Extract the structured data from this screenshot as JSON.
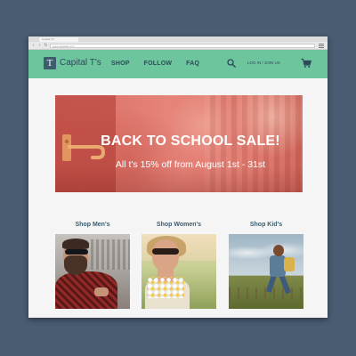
{
  "browser": {
    "tab_title": "Capital T's",
    "url": "www.capitalts.com"
  },
  "header": {
    "logo_letter": "T",
    "logo_text": "Capital T's",
    "nav": [
      "SHOP",
      "FOLLOW",
      "FAQ"
    ],
    "signin_text": "LOG IN  /  JOIN US",
    "search_icon": "search-icon",
    "cart_icon": "cart-icon",
    "bg_color": "#6cc59c",
    "text_color": "#2c4a5a"
  },
  "hero": {
    "title": "BACK TO SCHOOL SALE!",
    "subtitle": "All t's 15% off from August 1st - 31st",
    "overlay_color": "#e27a6f"
  },
  "categories": [
    {
      "label": "Shop Men's"
    },
    {
      "label": "Shop Women's"
    },
    {
      "label": "Shop Kid's"
    }
  ],
  "colors": {
    "page_background": "#4a5c72",
    "heading": "#3d5c6e"
  }
}
